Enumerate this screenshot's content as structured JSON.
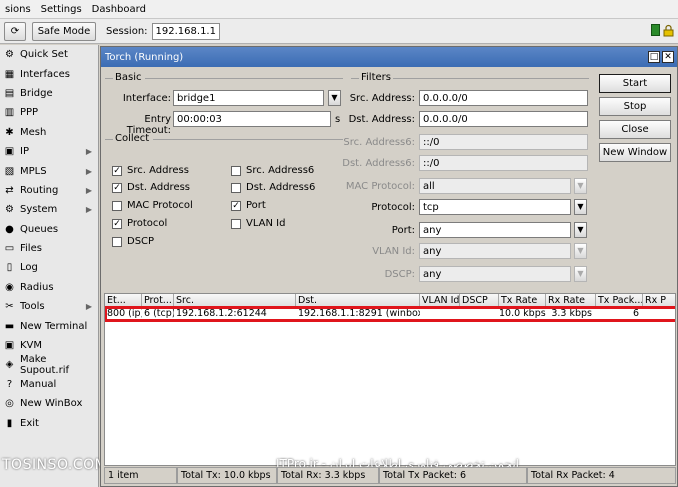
{
  "menu": [
    "sions",
    "Settings",
    "Dashboard"
  ],
  "toolbar": {
    "refresh_icon": "refresh-icon",
    "safe_mode": "Safe Mode",
    "session_label": "Session:",
    "session_value": "192.168.1.1"
  },
  "sidebar": {
    "items": [
      {
        "label": "Quick Set",
        "icon": "quick-set-icon",
        "glyph": "⚙",
        "arrow": false
      },
      {
        "label": "Interfaces",
        "icon": "interfaces-icon",
        "glyph": "▦",
        "arrow": false
      },
      {
        "label": "Bridge",
        "icon": "bridge-icon",
        "glyph": "▤",
        "arrow": false
      },
      {
        "label": "PPP",
        "icon": "ppp-icon",
        "glyph": "▥",
        "arrow": false
      },
      {
        "label": "Mesh",
        "icon": "mesh-icon",
        "glyph": "✱",
        "arrow": false
      },
      {
        "label": "IP",
        "icon": "ip-icon",
        "glyph": "▣",
        "arrow": true
      },
      {
        "label": "MPLS",
        "icon": "mpls-icon",
        "glyph": "▧",
        "arrow": true
      },
      {
        "label": "Routing",
        "icon": "routing-icon",
        "glyph": "⇄",
        "arrow": true
      },
      {
        "label": "System",
        "icon": "system-icon",
        "glyph": "⚙",
        "arrow": true
      },
      {
        "label": "Queues",
        "icon": "queues-icon",
        "glyph": "●",
        "arrow": false
      },
      {
        "label": "Files",
        "icon": "files-icon",
        "glyph": "▭",
        "arrow": false
      },
      {
        "label": "Log",
        "icon": "log-icon",
        "glyph": "▯",
        "arrow": false
      },
      {
        "label": "Radius",
        "icon": "radius-icon",
        "glyph": "◉",
        "arrow": false
      },
      {
        "label": "Tools",
        "icon": "tools-icon",
        "glyph": "✂",
        "arrow": true
      },
      {
        "label": "New Terminal",
        "icon": "terminal-icon",
        "glyph": "▬",
        "arrow": false
      },
      {
        "label": "KVM",
        "icon": "kvm-icon",
        "glyph": "▣",
        "arrow": false
      },
      {
        "label": "Make Supout.rif",
        "icon": "supout-icon",
        "glyph": "◈",
        "arrow": false
      },
      {
        "label": "Manual",
        "icon": "manual-icon",
        "glyph": "?",
        "arrow": false
      },
      {
        "label": "New WinBox",
        "icon": "winbox-icon",
        "glyph": "◎",
        "arrow": false
      },
      {
        "label": "Exit",
        "icon": "exit-icon",
        "glyph": "▮",
        "arrow": false
      }
    ],
    "watermark": "TOSINSO.COM"
  },
  "window": {
    "title": "Torch (Running)",
    "basic_group": "Basic",
    "interface_label": "Interface:",
    "interface_value": "bridge1",
    "timeout_label": "Entry Timeout:",
    "timeout_value": "00:00:03",
    "timeout_unit": "s",
    "collect_group": "Collect",
    "collect": [
      {
        "label": "Src. Address",
        "checked": true
      },
      {
        "label": "Src. Address6",
        "checked": false
      },
      {
        "label": "Dst. Address",
        "checked": true
      },
      {
        "label": "Dst. Address6",
        "checked": false
      },
      {
        "label": "MAC Protocol",
        "checked": false
      },
      {
        "label": "Port",
        "checked": true
      },
      {
        "label": "Protocol",
        "checked": true
      },
      {
        "label": "VLAN Id",
        "checked": false
      },
      {
        "label": "DSCP",
        "checked": false
      }
    ],
    "filters_group": "Filters",
    "filters": [
      {
        "label": "Src. Address:",
        "value": "0.0.0.0/0",
        "enabled": true,
        "dropdown": false
      },
      {
        "label": "Dst. Address:",
        "value": "0.0.0.0/0",
        "enabled": true,
        "dropdown": false
      },
      {
        "label": "Src. Address6:",
        "value": "::/0",
        "enabled": false,
        "dropdown": false
      },
      {
        "label": "Dst. Address6:",
        "value": "::/0",
        "enabled": false,
        "dropdown": false
      },
      {
        "label": "MAC Protocol:",
        "value": "all",
        "enabled": false,
        "dropdown": true
      },
      {
        "label": "Protocol:",
        "value": "tcp",
        "enabled": true,
        "dropdown": true
      },
      {
        "label": "Port:",
        "value": "any",
        "enabled": true,
        "dropdown": true
      },
      {
        "label": "VLAN Id:",
        "value": "any",
        "enabled": false,
        "dropdown": true
      },
      {
        "label": "DSCP:",
        "value": "any",
        "enabled": false,
        "dropdown": true
      }
    ],
    "buttons": [
      "Start",
      "Stop",
      "Close",
      "New Window"
    ],
    "columns": [
      "Et...",
      "Prot...",
      "Src.",
      "Dst.",
      "VLAN Id",
      "DSCP",
      "Tx Rate",
      "Rx Rate",
      "Tx Pack...",
      "Rx P"
    ],
    "row": [
      "800 (ip)",
      "6 (tcp)",
      "192.168.1.2:61244",
      "192.168.1.1:8291 (winbox)",
      "",
      "",
      "10.0 kbps",
      "3.3 kbps",
      "6",
      ""
    ],
    "status": [
      "1 item",
      "Total Tx: 10.0 kbps",
      "Total Rx: 3.3 kbps",
      "Total Tx Packet: 6",
      "Total Rx Packet: 4"
    ],
    "watermark": "ITPro.ir - انجمن تخصصی فناوری اطلاعات ایران"
  },
  "colors": {
    "title_bar": "#3b6cb4",
    "highlight": "#e0151c"
  }
}
